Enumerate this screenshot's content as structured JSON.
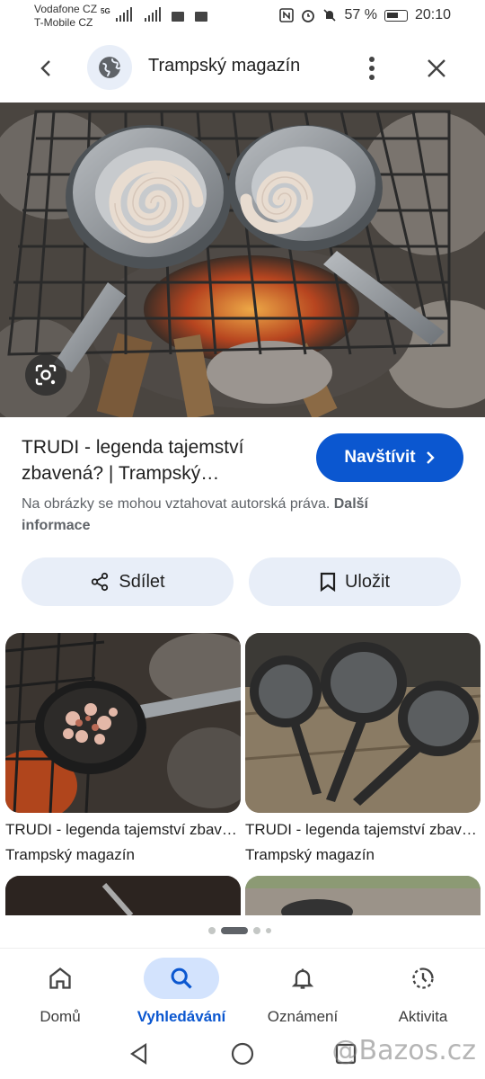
{
  "status_bar": {
    "carrier1": "Vodafone CZ",
    "carrier2": "T-Mobile CZ",
    "network": "5G",
    "battery": "57 %",
    "time": "20:10"
  },
  "header": {
    "title": "Trampský magazín",
    "icons": [
      "arrow-back-icon",
      "globe-icon",
      "more-vert-icon",
      "close-icon"
    ]
  },
  "result": {
    "title": "TRUDI - legenda tajemství zbavená? | Trampský…",
    "visit_label": "Navštívit",
    "copyright_text": "Na obrázky se mohou vztahovat autorská práva.",
    "more_info": "Další informace",
    "share_label": "Sdílet",
    "save_label": "Uložit"
  },
  "related": [
    {
      "title": "TRUDI - legenda tajemství zbavená?",
      "source": "Trampský magazín"
    },
    {
      "title": "TRUDI - legenda tajemství zbavená?",
      "source": "Trampský magazín"
    }
  ],
  "bottom_nav": {
    "items": [
      {
        "label": "Domů",
        "icon": "home-icon"
      },
      {
        "label": "Vyhledávání",
        "icon": "search-icon"
      },
      {
        "label": "Oznámení",
        "icon": "bell-icon"
      },
      {
        "label": "Aktivita",
        "icon": "activity-icon"
      }
    ],
    "active": "Vyhledávání"
  },
  "watermark": "@Bazos.cz",
  "colors": {
    "accent": "#0b57d0",
    "chip_bg": "#e8eef8",
    "nav_active_bg": "#d3e3fd"
  }
}
